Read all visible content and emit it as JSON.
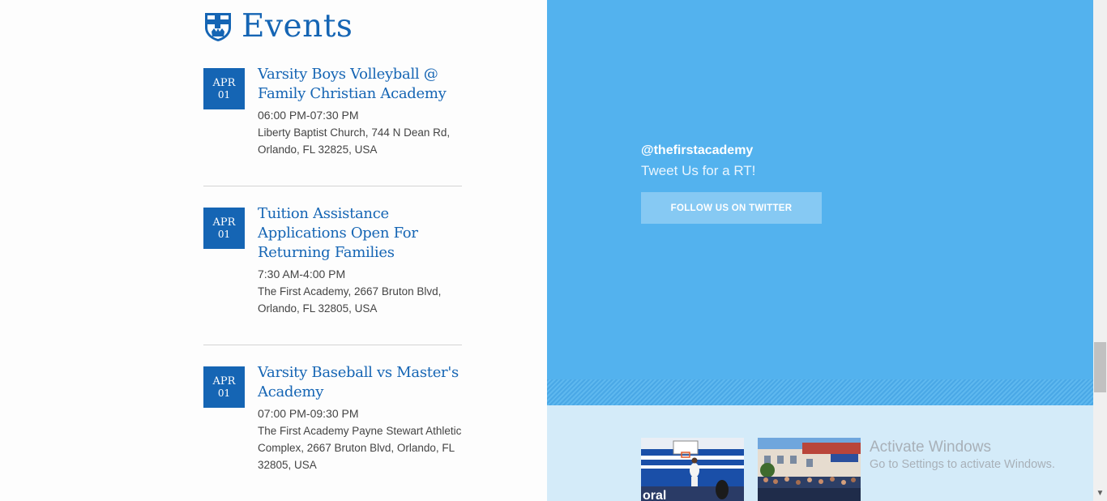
{
  "events": {
    "heading": "Events",
    "items": [
      {
        "month": "APR",
        "day": "01",
        "title": "Varsity Boys Volleyball @ Family Christian Academy",
        "time": "06:00 PM-07:30 PM",
        "location": "Liberty Baptist Church, 744 N Dean Rd, Orlando, FL 32825, USA"
      },
      {
        "month": "APR",
        "day": "01",
        "title": "Tuition Assistance Applications Open For Returning Families",
        "time": "7:30 AM-4:00 PM",
        "location": "The First Academy, 2667 Bruton Blvd, Orlando, FL 32805, USA"
      },
      {
        "month": "APR",
        "day": "01",
        "title": "Varsity Baseball vs Master's Academy",
        "time": "07:00 PM-09:30 PM",
        "location": "The First Academy Payne Stewart Athletic Complex, 2667 Bruton Blvd, Orlando, FL 32805, USA"
      }
    ]
  },
  "twitter": {
    "handle": "@thefirstacademy",
    "tagline": "Tweet Us for a RT!",
    "button_label": "FOLLOW US ON TWITTER"
  },
  "watermark": {
    "line1": "Activate Windows",
    "line2": "Go to Settings to activate Windows."
  },
  "colors": {
    "brand_blue": "#1565b4",
    "twitter_blue": "#53b2ee",
    "instagram_bg": "#d4ebf9"
  },
  "icons": {
    "crest": "school-crest-icon",
    "scroll_down": "chevron-down-icon"
  }
}
